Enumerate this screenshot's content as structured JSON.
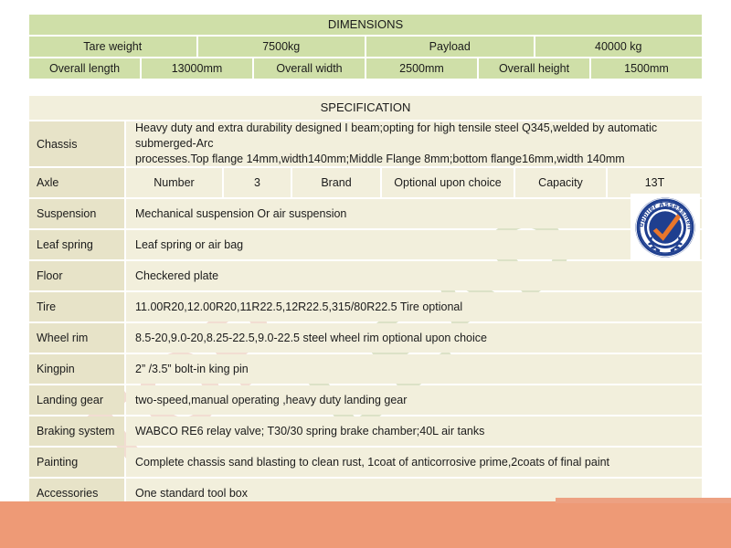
{
  "watermark": {
    "word1": "TOP",
    "word2": "LEAD"
  },
  "dimensions": {
    "title": "DIMENSIONS",
    "row2": [
      "Tare weight",
      "7500kg",
      "Payload",
      "40000 kg"
    ],
    "row3": [
      "Overall length",
      "13000mm",
      "Overall width",
      "2500mm",
      "Overall height",
      "1500mm"
    ]
  },
  "specification": {
    "title": "SPECIFICATION",
    "rows": [
      {
        "label": "Chassis",
        "line1": "Heavy duty and extra durability designed I beam;opting for high tensile steel Q345,welded by automatic submerged-Arc",
        "line2": "processes.Top flange 14mm,width140mm;Middle Flange 8mm;bottom flange16mm,width 140mm"
      },
      {
        "label": "Axle",
        "cells": [
          "Number",
          "3",
          "Brand",
          "Optional upon choice",
          "Capacity",
          "13T"
        ]
      },
      {
        "label": "Suspension",
        "value": "Mechanical suspension Or air suspension"
      },
      {
        "label": "Leaf spring",
        "value": "Leaf spring or air bag"
      },
      {
        "label": "Floor",
        "value": "Checkered plate"
      },
      {
        "label": "Tire",
        "value": "11.00R20,12.00R20,11R22.5,12R22.5,315/80R22.5 Tire optional"
      },
      {
        "label": "Wheel rim",
        "value": "8.5-20,9.0-20,8.25-22.5,9.0-22.5 steel wheel rim optional upon choice"
      },
      {
        "label": "Kingpin",
        "value": "2” /3.5” bolt-in king pin"
      },
      {
        "label": "Landing gear",
        "value": "two-speed,manual operating ,heavy duty landing gear"
      },
      {
        "label": "Braking system",
        "value": "WABCO RE6 relay valve; T30/30 spring brake chamber;40L air tanks"
      },
      {
        "label": "Painting",
        "value": "Complete chassis sand blasting to clean rust, 1coat of anticorrosive prime,2coats of final paint"
      },
      {
        "label": "Accessories",
        "value": "One standard tool box"
      }
    ]
  },
  "badge": {
    "text": "Supplier Assessment",
    "icon": "check-seal-icon",
    "ring_color": "#1f3f8f",
    "check_color": "#e8762c"
  },
  "colors": {
    "dimension_cell": "#cfdfa8",
    "spec_label_cell": "#e7e3c8",
    "spec_value_cell": "#f2efdc",
    "bottom_bar": "#ee9a76",
    "page_background": "#ffffff"
  }
}
